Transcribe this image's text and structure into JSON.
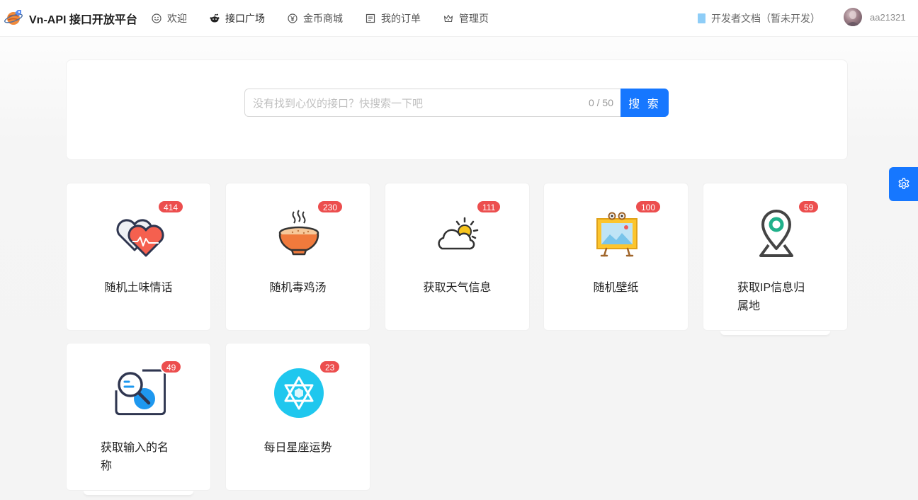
{
  "header": {
    "brand": "Vn-API 接口开放平台",
    "nav": [
      {
        "label": "欢迎",
        "icon": "smile-icon"
      },
      {
        "label": "接口广场",
        "icon": "reddit-icon"
      },
      {
        "label": "金币商城",
        "icon": "yen-coin-icon"
      },
      {
        "label": "我的订单",
        "icon": "order-list-icon"
      },
      {
        "label": "管理页",
        "icon": "crown-icon"
      }
    ],
    "doc_link": "开发者文档（暂未开发）",
    "username": "aa21321"
  },
  "search": {
    "placeholder": "没有找到心仪的接口？快搜索一下吧",
    "count": "0 / 50",
    "button": "搜 索"
  },
  "cards": [
    {
      "title": "随机土味情话",
      "count": "414",
      "icon": "double-heart-icon"
    },
    {
      "title": "随机毒鸡汤",
      "count": "230",
      "icon": "soup-bowl-icon"
    },
    {
      "title": "获取天气信息",
      "count": "111",
      "icon": "weather-cloud-sun-icon"
    },
    {
      "title": "随机壁纸",
      "count": "100",
      "icon": "wallpaper-frame-icon"
    },
    {
      "title": "获取IP信息归属地",
      "count": "59",
      "icon": "location-pin-icon"
    },
    {
      "title": "获取输入的名称",
      "count": "49",
      "icon": "search-card-icon"
    },
    {
      "title": "每日星座运势",
      "count": "23",
      "icon": "hexagram-star-icon"
    }
  ],
  "colors": {
    "primary": "#1677ff",
    "badge": "#ec4e4e"
  }
}
